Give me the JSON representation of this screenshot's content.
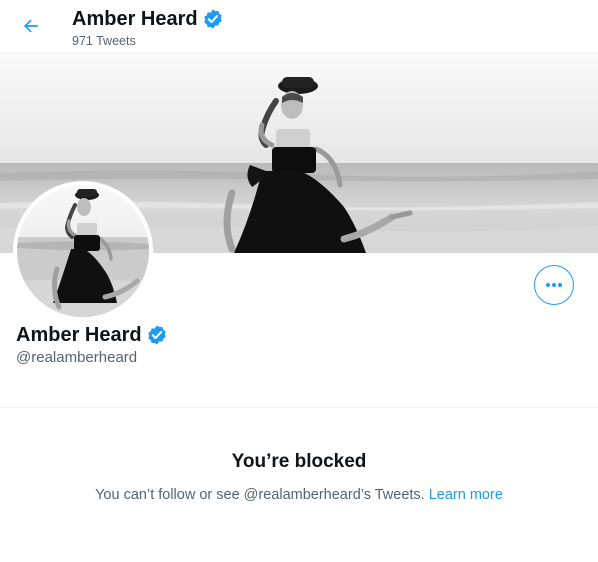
{
  "header": {
    "name": "Amber Heard",
    "tweet_count": "971 Tweets"
  },
  "profile": {
    "name": "Amber Heard",
    "handle": "@realamberheard",
    "verified": true
  },
  "blocked": {
    "title": "You’re blocked",
    "message": "You can’t follow or see @realamberheard’s Tweets.",
    "link": "Learn more"
  },
  "icons": {
    "back": "arrow-left-icon",
    "verified": "verified-badge-icon",
    "more": "more-dots-icon"
  },
  "colors": {
    "accent": "#1d9bf0",
    "text_primary": "#0f1419",
    "text_secondary": "#536471",
    "border": "#eff3f4"
  }
}
